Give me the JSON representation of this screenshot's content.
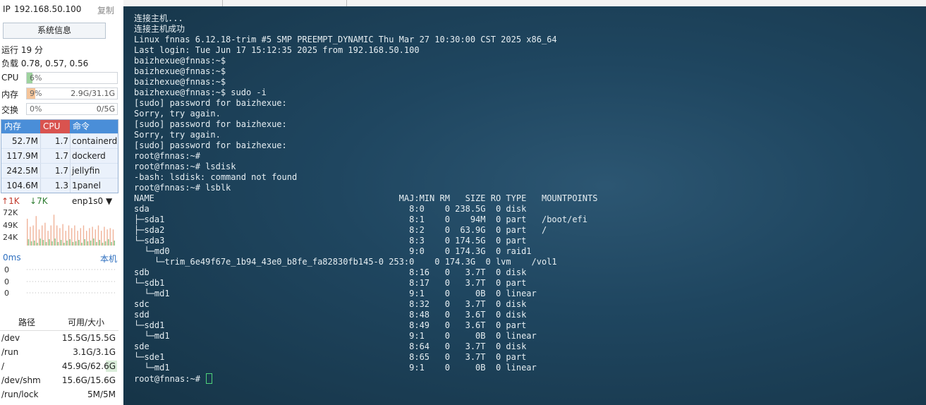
{
  "sidebar": {
    "ip_label": "IP",
    "ip_value": "192.168.50.100",
    "copy_label": "复制",
    "sysinfo_button": "系统信息",
    "uptime": "运行 19 分",
    "load": "负载 0.78, 0.57, 0.56",
    "meters": [
      {
        "label": "CPU",
        "percent_text": "6%",
        "amount": "",
        "fraction": 0.06,
        "color": "#9ed39e"
      },
      {
        "label": "内存",
        "percent_text": "9%",
        "amount": "2.9G/31.1G",
        "fraction": 0.09,
        "color": "#f5c59a"
      },
      {
        "label": "交换",
        "percent_text": "0%",
        "amount": "0/5G",
        "fraction": 0.0,
        "color": "#9ed39e"
      }
    ],
    "process_table": {
      "headers": {
        "mem": "内存",
        "cpu": "CPU",
        "cmd": "命令"
      },
      "header_colors": {
        "mem": "#4a8ed8",
        "cpu": "#d9534f",
        "cmd": "#4a8ed8"
      },
      "rows": [
        {
          "mem": "52.7M",
          "cpu": "1.7",
          "cmd": "containerd"
        },
        {
          "mem": "117.9M",
          "cpu": "1.7",
          "cmd": "dockerd"
        },
        {
          "mem": "242.5M",
          "cpu": "1.7",
          "cmd": "jellyfin"
        },
        {
          "mem": "104.6M",
          "cpu": "1.3",
          "cmd": "1panel"
        }
      ]
    },
    "network": {
      "upload": "1K",
      "download": "7K",
      "interface": "enp1s0",
      "y_labels": [
        "72K",
        "49K",
        "24K"
      ]
    },
    "latency": {
      "value": "0ms",
      "location": "本机",
      "y_labels": [
        "0",
        "0",
        "0"
      ]
    },
    "disk_table": {
      "headers": {
        "path": "路径",
        "size": "可用/大小"
      },
      "rows": [
        {
          "path": "/dev",
          "size": "15.5G/15.5G",
          "used_fraction": 0.0
        },
        {
          "path": "/run",
          "size": "3.1G/3.1G",
          "used_fraction": 0.0
        },
        {
          "path": "/",
          "size": "45.9G/62.6G",
          "used_fraction": 0.27
        },
        {
          "path": "/dev/shm",
          "size": "15.6G/15.6G",
          "used_fraction": 0.0
        },
        {
          "path": "/run/lock",
          "size": "5M/5M",
          "used_fraction": 0.0
        }
      ]
    }
  },
  "terminal": {
    "lines": [
      "连接主机...",
      "连接主机成功",
      "Linux fnnas 6.12.18-trim #5 SMP PREEMPT_DYNAMIC Thu Mar 27 10:30:00 CST 2025 x86_64",
      "Last login: Tue Jun 17 15:12:35 2025 from 192.168.50.100",
      "baizhexue@fnnas:~$",
      "baizhexue@fnnas:~$",
      "baizhexue@fnnas:~$",
      "baizhexue@fnnas:~$ sudo -i",
      "[sudo] password for baizhexue:",
      "Sorry, try again.",
      "[sudo] password for baizhexue:",
      "Sorry, try again.",
      "[sudo] password for baizhexue:",
      "root@fnnas:~#",
      "root@fnnas:~# lsdisk",
      "-bash: lsdisk: command not found",
      "root@fnnas:~# lsblk",
      "NAME                                                MAJ:MIN RM   SIZE RO TYPE   MOUNTPOINTS",
      "sda                                                   8:0    0 238.5G  0 disk",
      "├─sda1                                                8:1    0    94M  0 part   /boot/efi",
      "├─sda2                                                8:2    0  63.9G  0 part   /",
      "└─sda3                                                8:3    0 174.5G  0 part",
      "  └─md0                                               9:0    0 174.3G  0 raid1",
      "    └─trim_6e49f67e_1b94_43e0_b8fe_fa82830fb145-0 253:0    0 174.3G  0 lvm    /vol1",
      "sdb                                                   8:16   0   3.7T  0 disk",
      "└─sdb1                                                8:17   0   3.7T  0 part",
      "  └─md1                                               9:1    0     0B  0 linear",
      "sdc                                                   8:32   0   3.7T  0 disk",
      "sdd                                                   8:48   0   3.6T  0 disk",
      "└─sdd1                                                8:49   0   3.6T  0 part",
      "  └─md1                                               9:1    0     0B  0 linear",
      "sde                                                   8:64   0   3.7T  0 disk",
      "└─sde1                                                8:65   0   3.7T  0 part",
      "  └─md1                                               9:1    0     0B  0 linear",
      "root@fnnas:~#"
    ]
  }
}
